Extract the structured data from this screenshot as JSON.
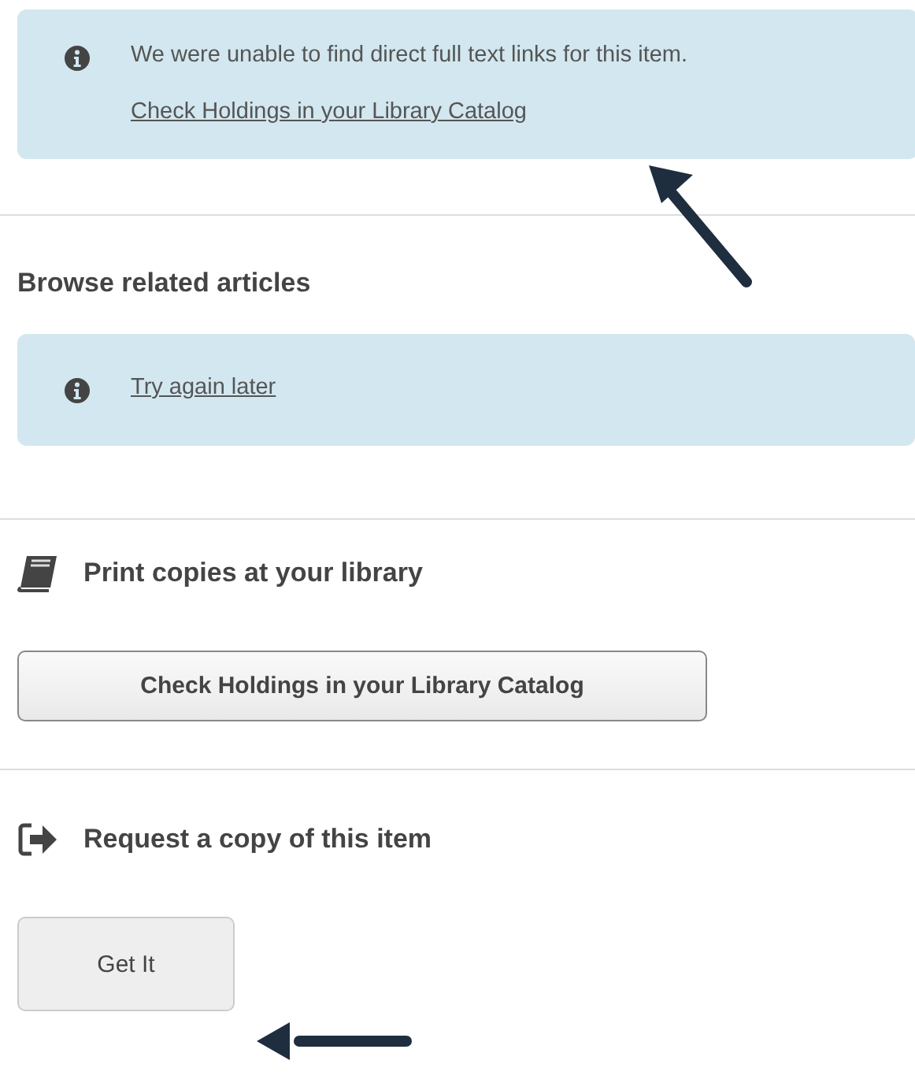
{
  "full_text_notice": {
    "message": "We were unable to find direct full text links for this item.",
    "link": "Check Holdings in your Library Catalog"
  },
  "browse_related": {
    "heading": "Browse related articles",
    "notice": {
      "link": "Try again later"
    }
  },
  "print_copies": {
    "heading": "Print copies at your library",
    "button": "Check Holdings in your Library Catalog"
  },
  "request_copy": {
    "heading": "Request a copy of this item",
    "button": "Get It"
  }
}
